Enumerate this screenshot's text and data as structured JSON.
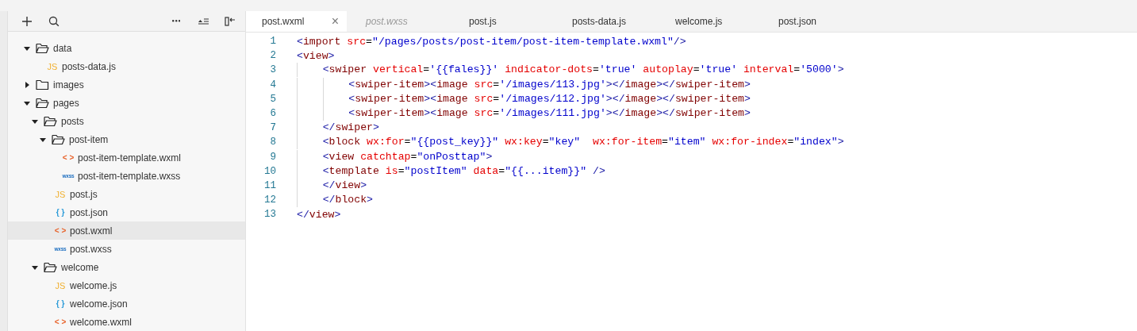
{
  "toolbar": {
    "buttons": [
      {
        "kind": "add"
      },
      {
        "kind": "search"
      },
      {
        "kind": "more"
      },
      {
        "kind": "outline"
      },
      {
        "kind": "collapse"
      }
    ]
  },
  "tree": [
    {
      "name": "data",
      "kind": "folder",
      "expanded": true,
      "selected": false,
      "children": [
        {
          "name": "posts-data.js",
          "kind": "js",
          "badge": "JS",
          "selected": false
        }
      ]
    },
    {
      "name": "images",
      "kind": "folder",
      "expanded": false,
      "selected": false
    },
    {
      "name": "pages",
      "kind": "folder",
      "expanded": true,
      "selected": false,
      "children": [
        {
          "name": "posts",
          "kind": "folder",
          "expanded": true,
          "selected": false,
          "children": [
            {
              "name": "post-item",
              "kind": "folder",
              "expanded": true,
              "selected": false,
              "children": [
                {
                  "name": "post-item-template.wxml",
                  "kind": "wxml",
                  "badge": "< >",
                  "selected": false
                },
                {
                  "name": "post-item-template.wxss",
                  "kind": "wxss",
                  "badge": "wxss",
                  "selected": false
                }
              ]
            },
            {
              "name": "post.js",
              "kind": "js",
              "badge": "JS",
              "selected": false
            },
            {
              "name": "post.json",
              "kind": "json",
              "badge": "{ }",
              "selected": false
            },
            {
              "name": "post.wxml",
              "kind": "wxml",
              "badge": "< >",
              "selected": true
            },
            {
              "name": "post.wxss",
              "kind": "wxss",
              "badge": "wxss",
              "selected": false
            }
          ]
        },
        {
          "name": "welcome",
          "kind": "folder",
          "expanded": true,
          "selected": false,
          "children": [
            {
              "name": "welcome.js",
              "kind": "js",
              "badge": "JS",
              "selected": false
            },
            {
              "name": "welcome.json",
              "kind": "json",
              "badge": "{ }",
              "selected": false
            },
            {
              "name": "welcome.wxml",
              "kind": "wxml",
              "badge": "< >",
              "selected": false
            }
          ]
        }
      ]
    }
  ],
  "tabs": [
    {
      "label": "post.wxml",
      "selected": true,
      "preview": false,
      "close": "×"
    },
    {
      "label": "post.wxss",
      "selected": false,
      "preview": true
    },
    {
      "label": "post.js",
      "selected": false,
      "preview": false
    },
    {
      "label": "posts-data.js",
      "selected": false,
      "preview": false
    },
    {
      "label": "welcome.js",
      "selected": false,
      "preview": false
    },
    {
      "label": "post.json",
      "selected": false,
      "preview": false
    }
  ],
  "editor": {
    "lines": [
      {
        "number": "1",
        "tokens": [
          {
            "kind": "p",
            "text": "<"
          },
          {
            "kind": "t",
            "text": "import"
          },
          {
            "kind": "a",
            "text": " src"
          },
          {
            "kind": "x",
            "text": "="
          },
          {
            "kind": "s",
            "text": "\"/pages/posts/post-item/post-item-template.wxml\""
          },
          {
            "kind": "p",
            "text": "/>"
          }
        ]
      },
      {
        "number": "2",
        "tokens": [
          {
            "kind": "p",
            "text": "<"
          },
          {
            "kind": "t",
            "text": "view"
          },
          {
            "kind": "p",
            "text": ">"
          }
        ]
      },
      {
        "number": "3",
        "tokens": [
          {
            "kind": "p",
            "text": "    <"
          },
          {
            "kind": "t",
            "text": "swiper"
          },
          {
            "kind": "a",
            "text": " vertical"
          },
          {
            "kind": "x",
            "text": "="
          },
          {
            "kind": "s",
            "text": "'{{fales}}'"
          },
          {
            "kind": "a",
            "text": " indicator-dots"
          },
          {
            "kind": "x",
            "text": "="
          },
          {
            "kind": "s",
            "text": "'true'"
          },
          {
            "kind": "a",
            "text": " autoplay"
          },
          {
            "kind": "x",
            "text": "="
          },
          {
            "kind": "s",
            "text": "'true'"
          },
          {
            "kind": "a",
            "text": " interval"
          },
          {
            "kind": "x",
            "text": "="
          },
          {
            "kind": "s",
            "text": "'5000'"
          },
          {
            "kind": "p",
            "text": ">"
          }
        ]
      },
      {
        "number": "4",
        "tokens": [
          {
            "kind": "p",
            "text": "        <"
          },
          {
            "kind": "t",
            "text": "swiper-item"
          },
          {
            "kind": "p",
            "text": "><"
          },
          {
            "kind": "t",
            "text": "image"
          },
          {
            "kind": "a",
            "text": " src"
          },
          {
            "kind": "x",
            "text": "="
          },
          {
            "kind": "s",
            "text": "'/images/113.jpg'"
          },
          {
            "kind": "p",
            "text": "></"
          },
          {
            "kind": "t",
            "text": "image"
          },
          {
            "kind": "p",
            "text": "></"
          },
          {
            "kind": "t",
            "text": "swiper-item"
          },
          {
            "kind": "p",
            "text": ">"
          }
        ]
      },
      {
        "number": "5",
        "tokens": [
          {
            "kind": "p",
            "text": "        <"
          },
          {
            "kind": "t",
            "text": "swiper-item"
          },
          {
            "kind": "p",
            "text": "><"
          },
          {
            "kind": "t",
            "text": "image"
          },
          {
            "kind": "a",
            "text": " src"
          },
          {
            "kind": "x",
            "text": "="
          },
          {
            "kind": "s",
            "text": "'/images/112.jpg'"
          },
          {
            "kind": "p",
            "text": "></"
          },
          {
            "kind": "t",
            "text": "image"
          },
          {
            "kind": "p",
            "text": "></"
          },
          {
            "kind": "t",
            "text": "swiper-item"
          },
          {
            "kind": "p",
            "text": ">"
          }
        ]
      },
      {
        "number": "6",
        "tokens": [
          {
            "kind": "p",
            "text": "        <"
          },
          {
            "kind": "t",
            "text": "swiper-item"
          },
          {
            "kind": "p",
            "text": "><"
          },
          {
            "kind": "t",
            "text": "image"
          },
          {
            "kind": "a",
            "text": " src"
          },
          {
            "kind": "x",
            "text": "="
          },
          {
            "kind": "s",
            "text": "'/images/111.jpg'"
          },
          {
            "kind": "p",
            "text": "></"
          },
          {
            "kind": "t",
            "text": "image"
          },
          {
            "kind": "p",
            "text": "></"
          },
          {
            "kind": "t",
            "text": "swiper-item"
          },
          {
            "kind": "p",
            "text": ">"
          }
        ]
      },
      {
        "number": "7",
        "tokens": [
          {
            "kind": "p",
            "text": "    </"
          },
          {
            "kind": "t",
            "text": "swiper"
          },
          {
            "kind": "p",
            "text": ">"
          }
        ]
      },
      {
        "number": "8",
        "tokens": [
          {
            "kind": "p",
            "text": "    <"
          },
          {
            "kind": "t",
            "text": "block"
          },
          {
            "kind": "a",
            "text": " wx:for"
          },
          {
            "kind": "x",
            "text": "="
          },
          {
            "kind": "s",
            "text": "\"{{post_key}}\""
          },
          {
            "kind": "a",
            "text": " wx:key"
          },
          {
            "kind": "x",
            "text": "="
          },
          {
            "kind": "s",
            "text": "\"key\""
          },
          {
            "kind": "a",
            "text": "  wx:for-item"
          },
          {
            "kind": "x",
            "text": "="
          },
          {
            "kind": "s",
            "text": "\"item\""
          },
          {
            "kind": "a",
            "text": " wx:for-index"
          },
          {
            "kind": "x",
            "text": "="
          },
          {
            "kind": "s",
            "text": "\"index\""
          },
          {
            "kind": "p",
            "text": ">"
          }
        ]
      },
      {
        "number": "9",
        "tokens": [
          {
            "kind": "p",
            "text": "    <"
          },
          {
            "kind": "t",
            "text": "view"
          },
          {
            "kind": "a",
            "text": " catchtap"
          },
          {
            "kind": "x",
            "text": "="
          },
          {
            "kind": "s",
            "text": "\"onPosttap\""
          },
          {
            "kind": "p",
            "text": ">"
          }
        ]
      },
      {
        "number": "10",
        "tokens": [
          {
            "kind": "p",
            "text": "    <"
          },
          {
            "kind": "t",
            "text": "template"
          },
          {
            "kind": "a",
            "text": " is"
          },
          {
            "kind": "x",
            "text": "="
          },
          {
            "kind": "s",
            "text": "\"postItem\""
          },
          {
            "kind": "a",
            "text": " data"
          },
          {
            "kind": "x",
            "text": "="
          },
          {
            "kind": "s",
            "text": "\"{{...item}}\""
          },
          {
            "kind": "p",
            "text": " />"
          }
        ]
      },
      {
        "number": "11",
        "tokens": [
          {
            "kind": "p",
            "text": "    </"
          },
          {
            "kind": "t",
            "text": "view"
          },
          {
            "kind": "p",
            "text": ">"
          }
        ]
      },
      {
        "number": "12",
        "tokens": [
          {
            "kind": "p",
            "text": "    </"
          },
          {
            "kind": "t",
            "text": "block"
          },
          {
            "kind": "p",
            "text": ">"
          }
        ]
      },
      {
        "number": "13",
        "tokens": [
          {
            "kind": "p",
            "text": "</"
          },
          {
            "kind": "t",
            "text": "view"
          },
          {
            "kind": "p",
            "text": ">"
          }
        ]
      }
    ]
  }
}
